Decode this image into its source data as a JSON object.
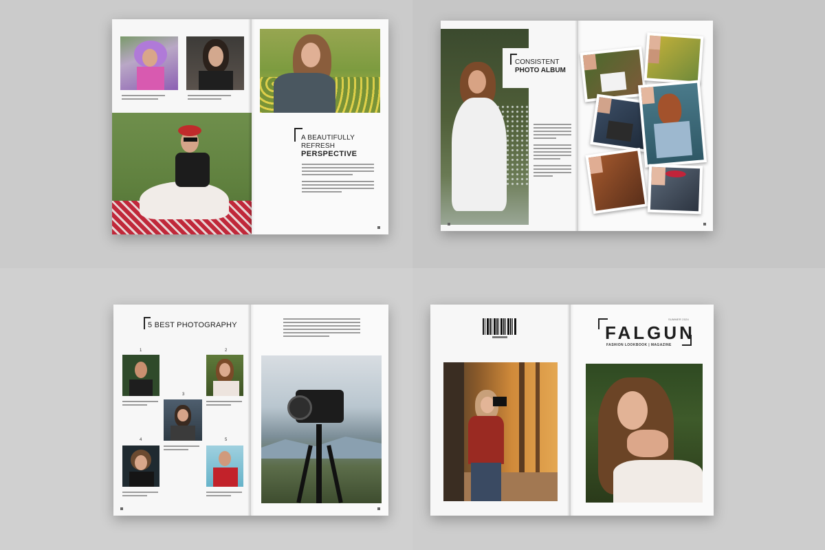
{
  "colors": {
    "background": "#cfcfcf",
    "paper": "#f7f7f7",
    "ink": "#222222"
  },
  "spread1": {
    "heading_line1": "A BEAUTIFULLY REFRESH",
    "heading_line2": "PERSPECTIVE"
  },
  "spread2": {
    "heading_line1": "CONSISTENT",
    "heading_line2": "PHOTO ALBUM"
  },
  "spread3": {
    "heading": "5 BEST PHOTOGRAPHY",
    "numbers": [
      "1",
      "2",
      "3",
      "4",
      "5"
    ]
  },
  "spread4": {
    "brand": "FALGUN",
    "tagline": "FASHION LOOKBOOK | MAGAZINE",
    "issue": "SUMMER 2024"
  },
  "icons": {
    "barcode": "barcode-icon"
  }
}
